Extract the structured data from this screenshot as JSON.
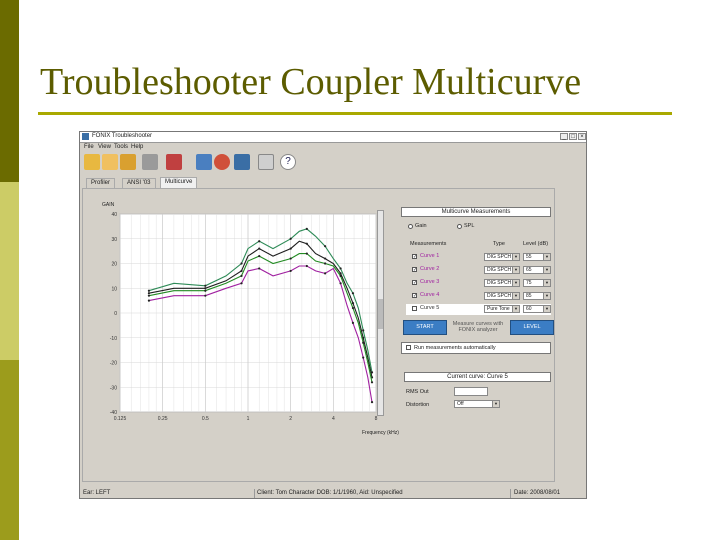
{
  "slide": {
    "title": "Troubleshooter Coupler Multicurve"
  },
  "window": {
    "title": "FONIX Troubleshooter",
    "controls": [
      "_",
      "□",
      "×"
    ],
    "menu": [
      "File",
      "View",
      "Tools",
      "Help"
    ],
    "toolbar_icons": [
      "open-folder-icon",
      "open-file-icon",
      "save-icon",
      "print-icon",
      "delete-icon",
      "arrows-icon",
      "stop-icon",
      "run-icon",
      "window-icon",
      "help-icon"
    ],
    "tabs": [
      "Profiler",
      "ANSI '03",
      "Multicurve"
    ],
    "active_tab": "Multicurve"
  },
  "graph": {
    "gain_label": "GAIN",
    "frequency_label": "Frequency (kHz)"
  },
  "chart_data": {
    "type": "line",
    "ylabel": "GAIN",
    "xlabel": "Frequency (kHz)",
    "x_ticks": [
      "0.125",
      "0.25",
      "0.5",
      "1",
      "2",
      "4",
      "8"
    ],
    "y_ticks": [
      40,
      30,
      20,
      10,
      0,
      -10,
      -20,
      -30,
      -40
    ],
    "ylim": [
      -40,
      40
    ],
    "x_log": true,
    "grid": true,
    "series": [
      {
        "color": "#2e8b57",
        "x": [
          0.2,
          0.3,
          0.5,
          0.7,
          0.9,
          1.0,
          1.2,
          1.5,
          2.0,
          2.3,
          2.6,
          3.0,
          3.5,
          4.0,
          4.5,
          5.0,
          5.5,
          6.0,
          6.5,
          7.0,
          7.5
        ],
        "y": [
          9,
          12,
          11,
          15,
          20,
          26,
          29,
          26,
          30,
          33,
          34,
          31,
          27,
          22,
          18,
          12,
          8,
          2,
          -7,
          -15,
          -24
        ]
      },
      {
        "color": "#1e1e1e",
        "x": [
          0.2,
          0.3,
          0.5,
          0.7,
          0.9,
          1.0,
          1.2,
          1.5,
          2.0,
          2.3,
          2.6,
          3.0,
          3.5,
          4.0,
          4.5,
          5.0,
          5.5,
          6.0,
          6.5,
          7.0,
          7.5
        ],
        "y": [
          8,
          10,
          10,
          13,
          17,
          23,
          26,
          23,
          26,
          29,
          28,
          24,
          22,
          20,
          16,
          10,
          4,
          -2,
          -10,
          -18,
          -26
        ]
      },
      {
        "color": "#228b22",
        "x": [
          0.2,
          0.3,
          0.5,
          0.7,
          0.9,
          1.0,
          1.2,
          1.5,
          2.0,
          2.3,
          2.6,
          3.0,
          3.5,
          4.0,
          4.5,
          5.0,
          5.5,
          6.0,
          6.5,
          7.0,
          7.5
        ],
        "y": [
          7,
          9,
          9,
          12,
          15,
          21,
          23,
          20,
          22,
          24,
          24,
          21,
          20,
          19,
          15,
          8,
          2,
          -4,
          -12,
          -20,
          -28
        ]
      },
      {
        "color": "#a020a0",
        "x": [
          0.2,
          0.3,
          0.5,
          0.7,
          0.9,
          1.0,
          1.2,
          1.5,
          2.0,
          2.3,
          2.6,
          3.0,
          3.5,
          4.0,
          4.5,
          5.0,
          5.5,
          6.0,
          6.5,
          7.0,
          7.5
        ],
        "y": [
          5,
          7,
          7,
          10,
          12,
          17,
          18,
          15,
          17,
          19,
          19,
          17,
          16,
          18,
          12,
          3,
          -4,
          -10,
          -18,
          -26,
          -36
        ]
      }
    ]
  },
  "right_panel": {
    "header": "Multicurve Measurements",
    "radio_gain": "Gain",
    "radio_spl": "SPL",
    "col_measurements": "Measurements",
    "col_type": "Type",
    "col_level": "Level (dB)",
    "curves": [
      {
        "label": "Curve 1",
        "type": "DIG SPCH",
        "level": "55",
        "checked": "✓",
        "color": "#a020a0"
      },
      {
        "label": "Curve 2",
        "type": "DIG SPCH",
        "level": "65",
        "checked": "✓",
        "color": "#a020a0"
      },
      {
        "label": "Curve 3",
        "type": "DIG SPCH",
        "level": "75",
        "checked": "✓",
        "color": "#a020a0"
      },
      {
        "label": "Curve 4",
        "type": "DIG SPCH",
        "level": "85",
        "checked": "✓",
        "color": "#a020a0"
      },
      {
        "label": "Curve 5",
        "type": "Pure Tone",
        "level": "60",
        "checked": "",
        "color": "#333333"
      }
    ],
    "start_label": "START",
    "measure_note": "Measure curves with FONIX analyzer",
    "level_label": "LEVEL",
    "auto_label": "Run measurements automatically",
    "current_curve": "Current curve: Curve 5",
    "rms_label": "RMS Out",
    "distortion_label": "Distortion",
    "distortion_value": "Off"
  },
  "status": {
    "ear": "Ear: LEFT",
    "client": "Client: Tom Character  DOB: 1/1/1960, Aid: Unspecified",
    "date": "Date: 2008/08/01"
  },
  "colors": {
    "accent_dark": "#6b6b00",
    "accent_light": "#cccc66",
    "title": "#5c5c00",
    "button_blue": "#3b7dc4"
  }
}
